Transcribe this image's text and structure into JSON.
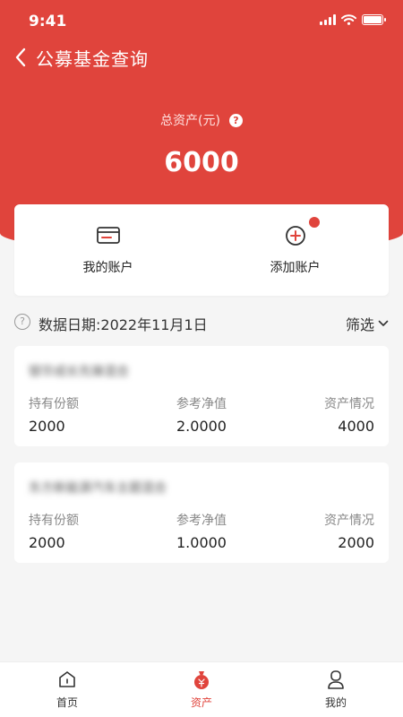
{
  "status_bar": {
    "time": "9:41"
  },
  "nav": {
    "title": "公募基金查询"
  },
  "summary": {
    "label": "总资产(元)",
    "help_glyph": "?",
    "total": "6000"
  },
  "accounts": {
    "my_account": "我的账户",
    "add_account": "添加账户"
  },
  "date_row": {
    "help_glyph": "?",
    "date_text": "数据日期:2022年11月1日",
    "filter_label": "筛选"
  },
  "funds": [
    {
      "name": "银华成长先锋混合",
      "cols": [
        {
          "header": "持有份额",
          "value": "2000"
        },
        {
          "header": "参考净值",
          "value": "2.0000"
        },
        {
          "header": "资产情况",
          "value": "4000"
        }
      ]
    },
    {
      "name": "东方新能源汽车主题混合",
      "cols": [
        {
          "header": "持有份额",
          "value": "2000"
        },
        {
          "header": "参考净值",
          "value": "1.0000"
        },
        {
          "header": "资产情况",
          "value": "2000"
        }
      ]
    }
  ],
  "tabbar": {
    "home": "首页",
    "assets": "资产",
    "mine": "我的"
  },
  "colors": {
    "brand_red": "#e0443c",
    "background": "#f5f5f5"
  }
}
